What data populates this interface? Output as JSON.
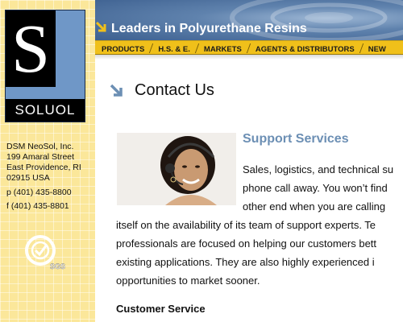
{
  "logo": {
    "letter": "S",
    "wordmark": "SOLUOL"
  },
  "company": {
    "name": "DSM NeoSol, Inc.",
    "street": "199 Amaral Street",
    "city": "East Providence, RI",
    "zip": "02915 USA",
    "phone": "p (401) 435-8800",
    "fax": "f (401) 435-8801"
  },
  "badge": {
    "label": "SGS"
  },
  "header": {
    "tagline": "Leaders in Polyurethane Resins",
    "nav": [
      "PRODUCTS",
      "H.S. & E.",
      "MARKETS",
      "AGENTS & DISTRIBUTORS",
      "NEW"
    ]
  },
  "main": {
    "title": "Contact Us",
    "support_title": "Support Services",
    "paragraph_lines": [
      "Sales, logistics, and technical su",
      "phone call away.  You won’t find",
      "other end when you are calling",
      "itself on the availability of its team of support experts.  Te",
      "professionals are focused on helping our customers bett",
      "existing applications.  They are also highly experienced i",
      "opportunities to market sooner."
    ],
    "customer_service_title": "Customer Service"
  },
  "colors": {
    "accent_blue": "#6c8fb4",
    "nav_yellow": "#f0c01a",
    "sidebar_yellow": "#fbe79a"
  }
}
